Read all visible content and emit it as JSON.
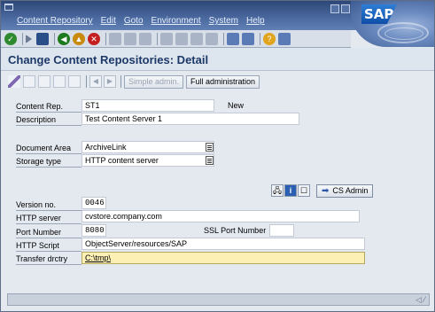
{
  "menu": {
    "items": [
      "Content Repository",
      "Edit",
      "Goto",
      "Environment",
      "System",
      "Help"
    ]
  },
  "logo": {
    "text": "SAP"
  },
  "title": "Change Content Repositories: Detail",
  "app_toolbar": {
    "simple_admin": "Simple admin.",
    "full_admin": "Full administration"
  },
  "form": {
    "content_rep": {
      "label": "Content Rep.",
      "value": "ST1",
      "status": "New"
    },
    "description": {
      "label": "Description",
      "value": "Test Content Server 1"
    },
    "document_area": {
      "label": "Document Area",
      "value": "ArchiveLink"
    },
    "storage_type": {
      "label": "Storage type",
      "value": "HTTP content server"
    },
    "version_no": {
      "label": "Version no.",
      "value": "0046"
    },
    "http_server": {
      "label": "HTTP server",
      "value": "cvstore.company.com"
    },
    "port_number": {
      "label": "Port Number",
      "value": "8080"
    },
    "ssl_port": {
      "label": "SSL Port Number",
      "value": ""
    },
    "http_script": {
      "label": "HTTP Script",
      "value": "ObjectServer/resources/SAP"
    },
    "transfer_dir": {
      "label": "Transfer drctry",
      "value": "C:\\tmp\\"
    }
  },
  "cs_admin": {
    "label": "CS Admin"
  },
  "icons": [
    "check-icon",
    "save-icon",
    "back-icon",
    "exit-icon",
    "cancel-icon",
    "print-icon",
    "find-icon",
    "help-icon"
  ]
}
